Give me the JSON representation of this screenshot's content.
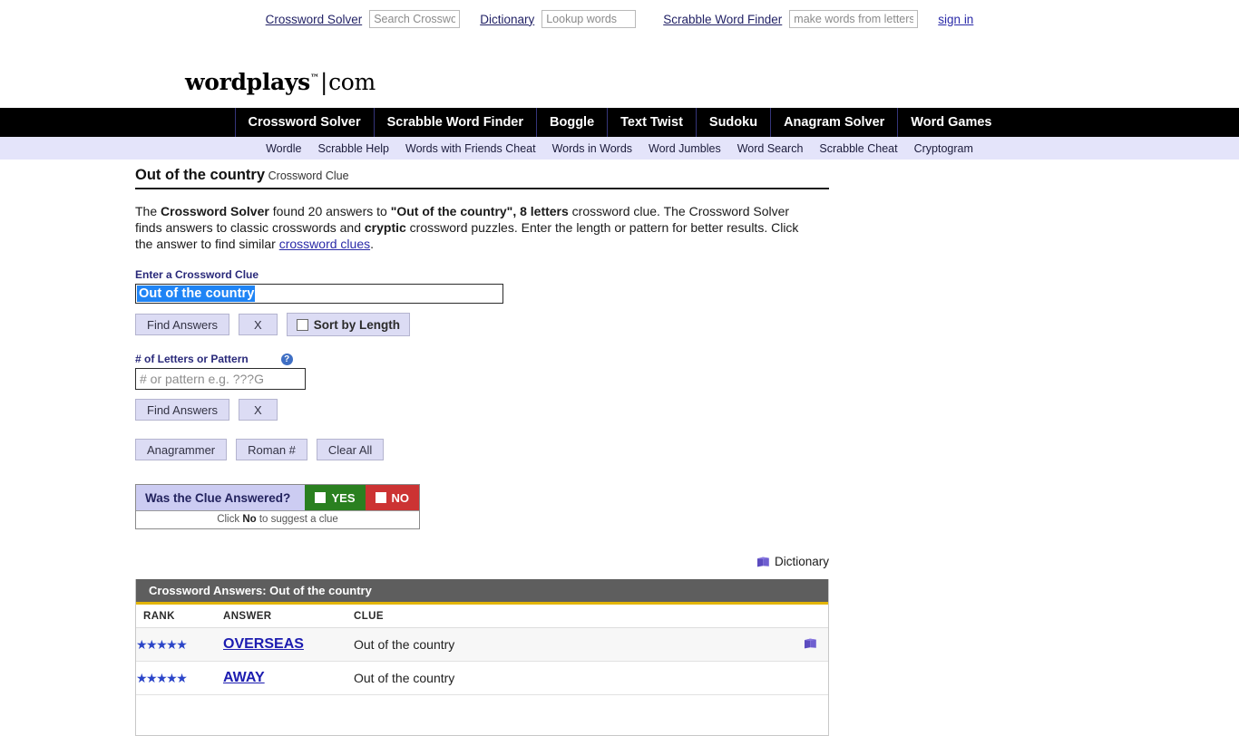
{
  "topbar": {
    "crossword_solver_link": "Crossword Solver",
    "crossword_solver_placeholder": "Search Crosswords",
    "dictionary_link": "Dictionary",
    "dictionary_placeholder": "Lookup words",
    "scrabble_link": "Scrabble Word Finder",
    "scrabble_placeholder": "make words from letters",
    "signin": "sign in"
  },
  "logo": {
    "brand": "wordplays",
    "tm": "™",
    "bar": "|",
    "com": "com"
  },
  "mainnav": {
    "items": [
      {
        "label": "Crossword Solver"
      },
      {
        "label": "Scrabble Word Finder"
      },
      {
        "label": "Boggle"
      },
      {
        "label": "Text Twist"
      },
      {
        "label": "Sudoku"
      },
      {
        "label": "Anagram Solver"
      },
      {
        "label": "Word Games"
      }
    ]
  },
  "subnav": {
    "items": [
      {
        "label": "Wordle"
      },
      {
        "label": "Scrabble Help"
      },
      {
        "label": "Words with Friends Cheat"
      },
      {
        "label": "Words in Words"
      },
      {
        "label": "Word Jumbles"
      },
      {
        "label": "Word Search"
      },
      {
        "label": "Scrabble Cheat"
      },
      {
        "label": "Cryptogram"
      }
    ]
  },
  "page": {
    "title_main": "Out of the country",
    "title_sub": "Crossword Clue",
    "intro_1": "The ",
    "intro_solver": "Crossword Solver",
    "intro_2": " found 20 answers to ",
    "intro_quote": "\"Out of the country\", 8 letters",
    "intro_3": " crossword clue. The Crossword Solver finds answers to classic crosswords and ",
    "intro_cryptic": "cryptic",
    "intro_4": " crossword puzzles. Enter the length or pattern for better results. Click the answer to find similar ",
    "intro_link": "crossword clues",
    "intro_5": "."
  },
  "form": {
    "clue_label": "Enter a Crossword Clue",
    "clue_value": "Out of the country",
    "find_answers": "Find Answers",
    "clear_x": "X",
    "sort_by_length": "Sort by Length",
    "pattern_label": "# of Letters or Pattern",
    "help_icon": "?",
    "pattern_placeholder": "# or pattern e.g. ???G",
    "pattern_value": "",
    "find_answers_2": "Find Answers",
    "clear_x_2": "X",
    "anagrammer": "Anagrammer",
    "roman": "Roman #",
    "clear_all": "Clear All"
  },
  "answered": {
    "question": "Was the Clue Answered?",
    "yes": "YES",
    "no": "NO",
    "hint_1": "Click ",
    "hint_bold": "No",
    "hint_2": " to suggest a clue"
  },
  "dictionary": {
    "label": "Dictionary"
  },
  "answers": {
    "header": "Crossword Answers: Out of the country",
    "columns": {
      "rank": "RANK",
      "answer": "ANSWER",
      "clue": "CLUE"
    },
    "rows": [
      {
        "stars": "★★★★★",
        "rank_value": 5,
        "answer": "OVERSEAS",
        "clue": "Out of the country",
        "has_dictionary_icon": true
      },
      {
        "stars": "★★★★★",
        "rank_value": 5,
        "answer": "AWAY",
        "clue": "Out of the country",
        "has_dictionary_icon": false
      }
    ]
  },
  "colors": {
    "nav_bg": "#000000",
    "subnav_bg": "#e4e4fa",
    "button_bg": "#dcdcf4",
    "yes_green": "#2a8020",
    "no_red": "#cc3333",
    "table_header_bg": "#5e5e5e",
    "table_header_rule": "#e3b505",
    "link_blue": "#1c1cb0",
    "star_blue": "#2b45c8",
    "selection_blue": "#1f84f5"
  }
}
